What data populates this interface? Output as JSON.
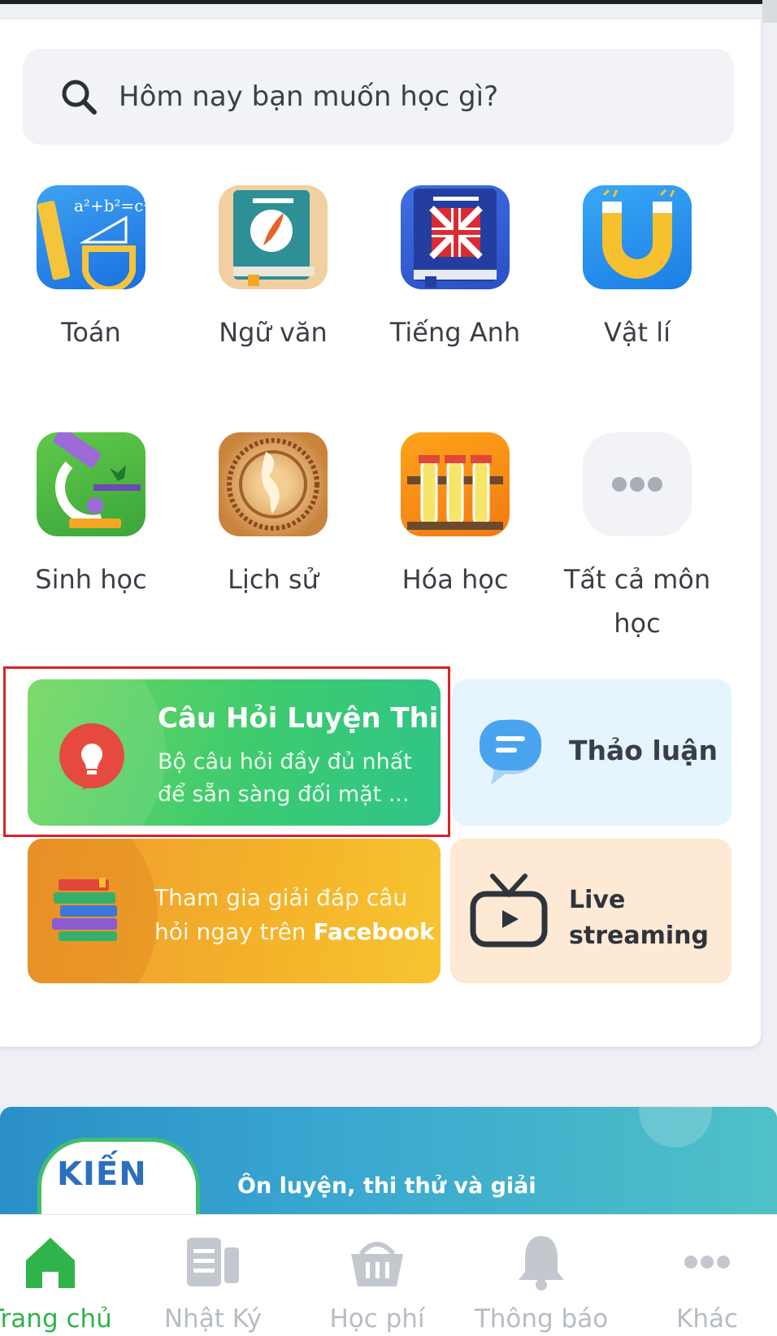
{
  "search": {
    "placeholder": "Hôm nay bạn muốn học gì?"
  },
  "subjects": [
    {
      "label": "Toán",
      "icon": "math-ruler-icon"
    },
    {
      "label": "Ngữ văn",
      "icon": "literature-book-icon"
    },
    {
      "label": "Tiếng Anh",
      "icon": "english-book-icon"
    },
    {
      "label": "Vật lí",
      "icon": "physics-magnet-icon"
    },
    {
      "label": "Sinh học",
      "icon": "biology-microscope-icon"
    },
    {
      "label": "Lịch sử",
      "icon": "history-map-icon"
    },
    {
      "label": "Hóa học",
      "icon": "chemistry-tubes-icon"
    },
    {
      "label": "Tất cả môn học",
      "icon": "more-dots-icon"
    }
  ],
  "features": {
    "exam": {
      "title": "Câu Hỏi Luyện Thi",
      "desc1": "Bộ câu hỏi đầy đủ nhất",
      "desc2": "để sẵn sàng đối mặt ...",
      "icon": "lightbulb-icon"
    },
    "discussion": {
      "title": "Thảo luận",
      "icon": "chat-bubble-icon"
    },
    "facebook": {
      "line1": "Tham gia giải đáp câu",
      "line2_prefix": "hỏi ngay trên ",
      "line2_bold": "Facebook",
      "icon": "books-stack-icon"
    },
    "live": {
      "line1": "Live",
      "line2": "streaming",
      "icon": "tv-play-icon"
    }
  },
  "banner": {
    "logo": "KIẾN",
    "caption": "Ôn luyện, thi thử và giải"
  },
  "nav": [
    {
      "label": "Trang chủ",
      "icon": "home-icon",
      "active": true
    },
    {
      "label": "Nhật Ký",
      "icon": "journal-icon"
    },
    {
      "label": "Học phí",
      "icon": "basket-icon"
    },
    {
      "label": "Thông báo",
      "icon": "bell-icon"
    },
    {
      "label": "Khác",
      "icon": "more-dots-icon"
    }
  ],
  "colors": {
    "accent_green": "#2fb34b",
    "highlight_red": "#d8232a"
  }
}
